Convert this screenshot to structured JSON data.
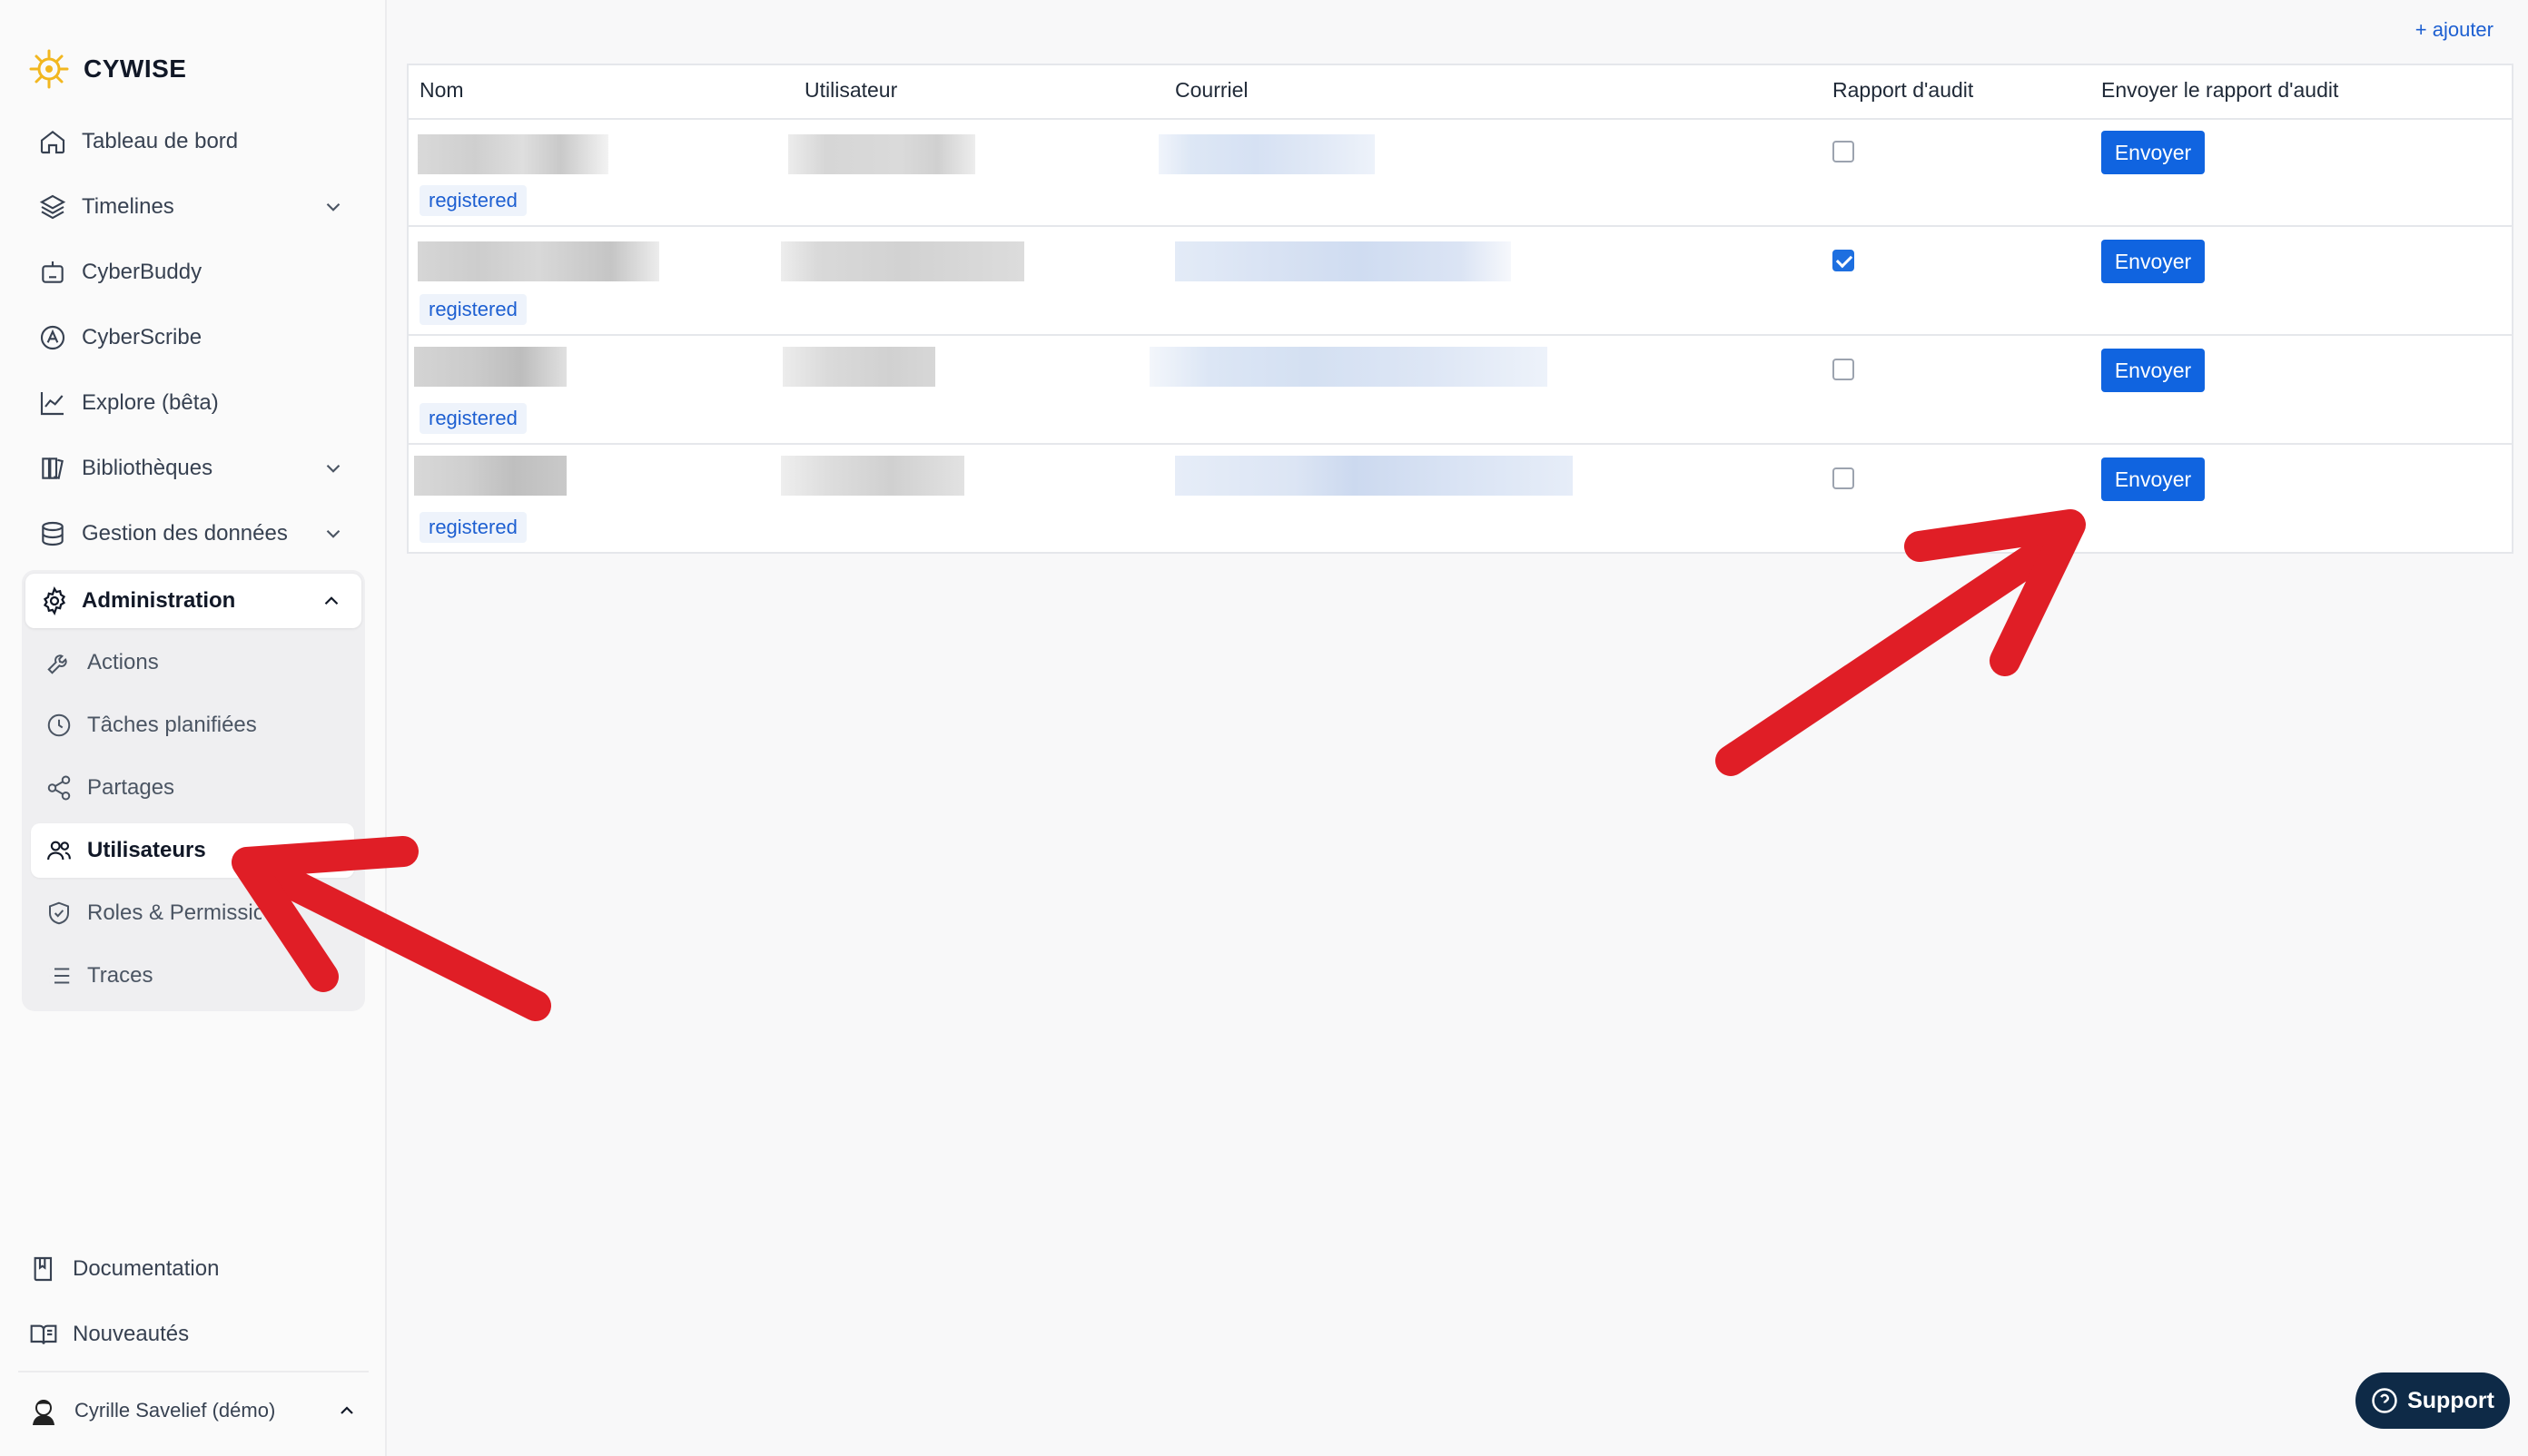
{
  "brand": {
    "name": "CYWISE",
    "accent": "#f2b71f"
  },
  "nav": {
    "items": [
      {
        "label": "Tableau de bord",
        "icon": "home-icon"
      },
      {
        "label": "Timelines",
        "icon": "layers-icon",
        "expandable": true
      },
      {
        "label": "CyberBuddy",
        "icon": "robot-icon"
      },
      {
        "label": "CyberScribe",
        "icon": "scribe-icon"
      },
      {
        "label": "Explore (bêta)",
        "icon": "chart-line-icon"
      },
      {
        "label": "Bibliothèques",
        "icon": "library-icon",
        "expandable": true
      },
      {
        "label": "Gestion des données",
        "icon": "database-icon",
        "expandable": true
      }
    ],
    "admin": {
      "label": "Administration",
      "icon": "gear-icon",
      "expanded": true,
      "items": [
        {
          "label": "Actions",
          "icon": "wrench-icon"
        },
        {
          "label": "Tâches planifiées",
          "icon": "clock-icon"
        },
        {
          "label": "Partages",
          "icon": "share-icon"
        },
        {
          "label": "Utilisateurs",
          "icon": "users-icon",
          "active": true
        },
        {
          "label": "Roles & Permissions",
          "icon": "shield-icon"
        },
        {
          "label": "Traces",
          "icon": "list-icon"
        }
      ]
    },
    "bottom": [
      {
        "label": "Documentation",
        "icon": "book-icon"
      },
      {
        "label": "Nouveautés",
        "icon": "book-open-icon"
      }
    ],
    "user": {
      "name": "Cyrille Savelief (démo)"
    }
  },
  "main": {
    "add_label": "+ ajouter",
    "columns": [
      "Nom",
      "Utilisateur",
      "Courriel",
      "Rapport d'audit",
      "Envoyer le rapport d'audit"
    ],
    "rows": [
      {
        "status": "registered",
        "audit_report": false,
        "send_label": "Envoyer"
      },
      {
        "status": "registered",
        "audit_report": true,
        "send_label": "Envoyer"
      },
      {
        "status": "registered",
        "audit_report": false,
        "send_label": "Envoyer"
      },
      {
        "status": "registered",
        "audit_report": false,
        "send_label": "Envoyer"
      }
    ]
  },
  "support": {
    "label": "Support"
  },
  "colors": {
    "primary": "#1064e0",
    "annotation_arrow": "#e01e26"
  }
}
